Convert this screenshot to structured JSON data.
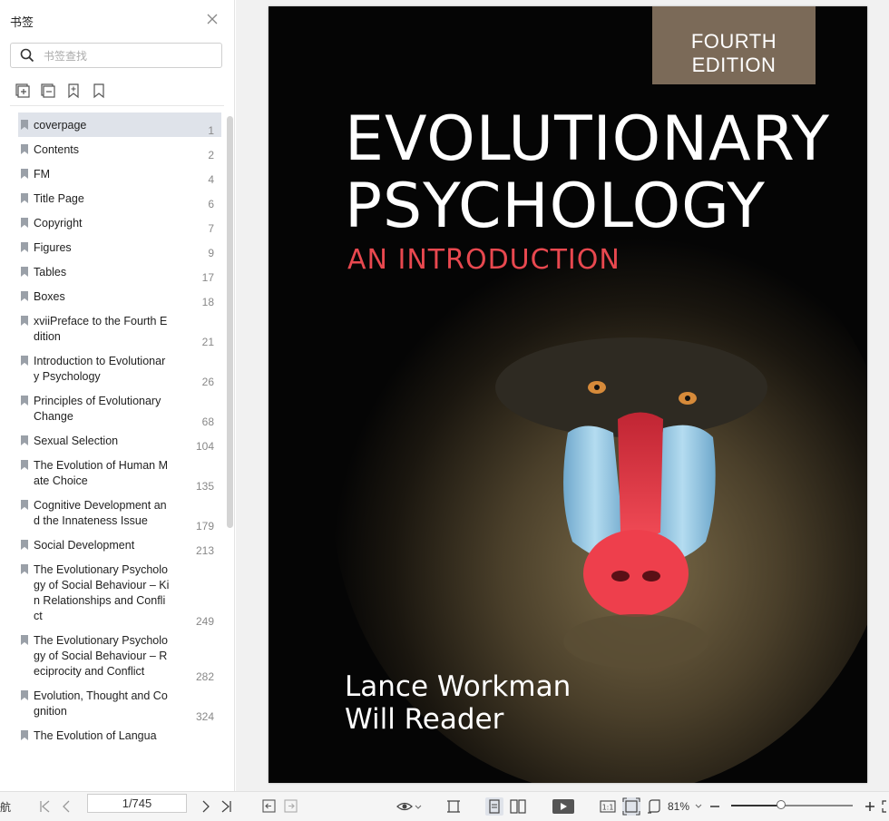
{
  "sidebar": {
    "title": "书签",
    "close_icon": "close-icon",
    "search_placeholder": "书签查找",
    "tools": [
      "expand-all-icon",
      "collapse-all-icon",
      "add-bookmark-icon",
      "bookmark-icon"
    ],
    "items": [
      {
        "label": "coverpage",
        "page": "1",
        "selected": true
      },
      {
        "label": "Contents",
        "page": "2"
      },
      {
        "label": "FM",
        "page": "4"
      },
      {
        "label": "Title Page",
        "page": "6"
      },
      {
        "label": "Copyright",
        "page": "7"
      },
      {
        "label": "Figures",
        "page": "9"
      },
      {
        "label": "Tables",
        "page": "17"
      },
      {
        "label": "Boxes",
        "page": "18"
      },
      {
        "label": "xviiPreface to the Fourth Edition",
        "page": "21"
      },
      {
        "label": "Introduction to Evolutionary Psychology",
        "page": "26"
      },
      {
        "label": "Principles of Evolutionary Change",
        "page": "68"
      },
      {
        "label": "Sexual Selection",
        "page": "104"
      },
      {
        "label": "The Evolution of Human Mate Choice",
        "page": "135"
      },
      {
        "label": "Cognitive Development and the Innateness Issue",
        "page": "179"
      },
      {
        "label": "Social Development",
        "page": "213"
      },
      {
        "label": "The Evolutionary Psychology of Social Behaviour – Kin Relationships and Conflict",
        "page": "249"
      },
      {
        "label": "The Evolutionary Psychology of Social Behaviour – Reciprocity and Conflict",
        "page": "282"
      },
      {
        "label": "Evolution, Thought and Cognition",
        "page": "324"
      },
      {
        "label": "The Evolution of Langua",
        "page": ""
      }
    ]
  },
  "cover": {
    "edition": "FOURTH EDITION",
    "title_line1": "EVOLUTIONARY",
    "title_line2": "PSYCHOLOGY",
    "subtitle": "AN INTRODUCTION",
    "author1": "Lance Workman",
    "author2": "Will Reader",
    "colors": {
      "background": "#050505",
      "subtitle": "#e8484f",
      "edition_bg": "#7b6a58",
      "mandrill_nose": "#e8333f",
      "mandrill_cheeks": "#8fc3e0"
    }
  },
  "toolbar": {
    "nav_label": "航",
    "page_value": "1/745",
    "zoom": "81%",
    "zoom_fraction": 0.41
  }
}
